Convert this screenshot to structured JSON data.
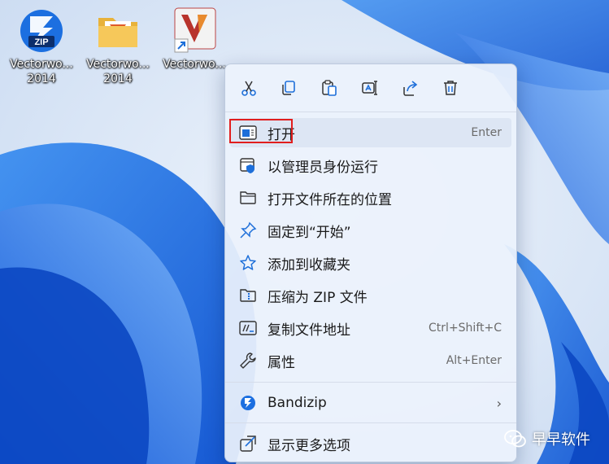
{
  "desktop": {
    "icons": [
      {
        "label": "Vectorwo... 2014",
        "line1": "Vectorwo...",
        "line2": "2014",
        "icon": "zip-archive-icon"
      },
      {
        "label": "Vectorwo... 2014",
        "line1": "Vectorwo...",
        "line2": "2014",
        "icon": "folder-icon"
      },
      {
        "label": "Vectorwo...",
        "line1": "Vectorwo...",
        "line2": "",
        "icon": "vectorworks-shortcut-icon"
      }
    ],
    "zip_badge": "ZIP"
  },
  "context_menu": {
    "quick_actions": [
      "cut-icon",
      "copy-icon",
      "paste-icon",
      "rename-icon",
      "share-icon",
      "delete-icon"
    ],
    "items": [
      {
        "label": "打开",
        "shortcut": "Enter",
        "icon": "open-window-icon"
      },
      {
        "label": "以管理员身份运行",
        "shortcut": "",
        "icon": "admin-shield-icon"
      },
      {
        "label": "打开文件所在的位置",
        "shortcut": "",
        "icon": "folder-outline-icon"
      },
      {
        "label": "固定到“开始”",
        "shortcut": "",
        "icon": "pin-icon"
      },
      {
        "label": "添加到收藏夹",
        "shortcut": "",
        "icon": "star-icon"
      },
      {
        "label": "压缩为 ZIP 文件",
        "shortcut": "",
        "icon": "zip-folder-icon"
      },
      {
        "label": "复制文件地址",
        "shortcut": "Ctrl+Shift+C",
        "icon": "copy-path-icon"
      },
      {
        "label": "属性",
        "shortcut": "Alt+Enter",
        "icon": "wrench-icon"
      },
      {
        "label": "Bandizip",
        "shortcut": "",
        "icon": "bandizip-icon"
      },
      {
        "label": "显示更多选项",
        "shortcut": "",
        "icon": "show-more-icon"
      }
    ]
  },
  "watermark": {
    "text": "早早软件",
    "icon": "wechat-icon"
  },
  "colors": {
    "highlight": "#e11e1e",
    "accent": "#1e6fd9"
  }
}
